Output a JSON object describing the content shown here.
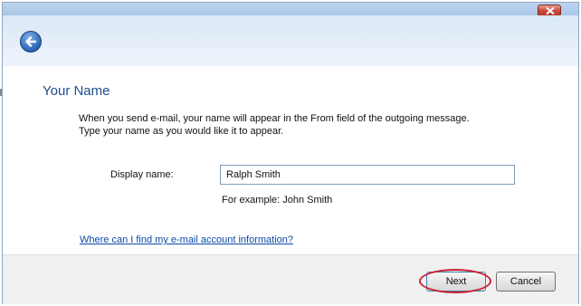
{
  "wizard": {
    "page_title": "Your Name",
    "instructions": [
      "When you send e-mail, your name will appear in the From field of the outgoing message.",
      "Type your name as you would like it to appear."
    ],
    "display_name": {
      "label": "Display name:",
      "value": "Ralph Smith",
      "example": "For example: John Smith"
    },
    "help_link": "Where can I find my e-mail account information?"
  },
  "footer": {
    "next_label": "Next",
    "cancel_label": "Cancel"
  },
  "icons": {
    "close": "close-icon",
    "back": "back-arrow-icon"
  },
  "colors": {
    "title": "#1e4e8c",
    "link": "#0a4aa8",
    "highlight_ring": "#cc2233",
    "close_button": "#c8483a"
  }
}
